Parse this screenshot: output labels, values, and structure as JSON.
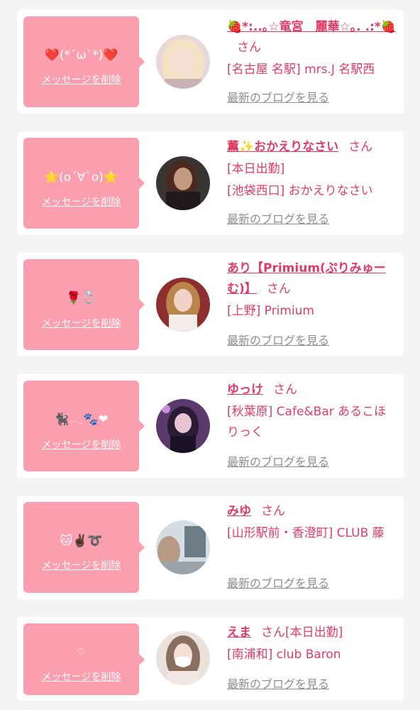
{
  "items": [
    {
      "message": "❤️(*´ω`*)❤️",
      "delete_label": "メッセージを削除",
      "name": "🍓*:..｡☆竜宮　麗華☆｡. .:*🍓",
      "honorific": "さん",
      "line1": "[名古屋 名駅] mrs.J 名駅西",
      "line2": "",
      "blog_label": "最新のブログを見る",
      "avatar_colors": [
        "#e8d8d8",
        "#f3e2c4",
        "#c9b2b4"
      ]
    },
    {
      "message": "⭐(o´∀`o)⭐",
      "delete_label": "メッセージを削除",
      "name": "薫✨おかえりなさい",
      "honorific": "さん",
      "line1": "[本日出勤]",
      "line2": "[池袋西口] おかえりなさい",
      "blog_label": "最新のブログを見る",
      "avatar_colors": [
        "#3a3432",
        "#c49a80",
        "#1f1a1a"
      ]
    },
    {
      "message": "🌹💍",
      "delete_label": "メッセージを削除",
      "name": "あり【Primium(ぷりみゅーむ)】",
      "honorific": "さん",
      "line1": "[上野] Primium",
      "line2": "",
      "blog_label": "最新のブログを見る",
      "avatar_colors": [
        "#8e2f2f",
        "#f0d4c8",
        "#b8864a"
      ]
    },
    {
      "message": "🐈‍⬛﻿𓂃🐾❤",
      "delete_label": "メッセージを削除",
      "name": "ゆっけ",
      "honorific": "さん",
      "line1": "[秋葉原] Cafe&Bar あるこほりっく",
      "line2": "",
      "blog_label": "最新のブログを見る",
      "avatar_colors": [
        "#5a3a6a",
        "#e6c4d2",
        "#2a1c34"
      ]
    },
    {
      "message": "🐱✌🏿➰",
      "delete_label": "メッセージを削除",
      "name": "みゆ",
      "honorific": "さん",
      "line1": "[山形駅前・香澄町] CLUB 藤",
      "line2": "",
      "blog_label": "最新のブログを見る",
      "avatar_colors": [
        "#d4dde4",
        "#b89a84",
        "#6c7c84"
      ]
    },
    {
      "message": "♡",
      "delete_label": "メッセージを削除",
      "name": "えま",
      "honorific": "さん[本日出勤]",
      "line1": "[南浦和] club Baron",
      "line2": "",
      "blog_label": "最新のブログを見る",
      "avatar_colors": [
        "#e9e1dc",
        "#8a6e5e",
        "#ffffff"
      ]
    }
  ]
}
